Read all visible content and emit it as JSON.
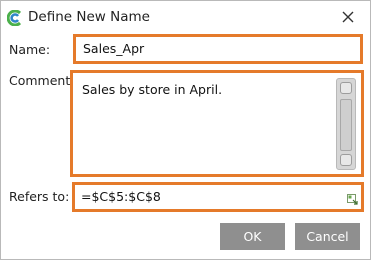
{
  "dialog": {
    "title": "Define New Name",
    "colors": {
      "highlight": "#e57a2a",
      "button_bg": "#8f8f8f",
      "logo_green": "#4bb04b",
      "logo_blue": "#2f86c9"
    }
  },
  "form": {
    "name_label": "Name:",
    "name_value": "Sales_Apr",
    "comment_label": "Comment:",
    "comment_value": "Sales by store in April.",
    "refers_label": "Refers to:",
    "refers_value": "=$C$5:$C$8"
  },
  "buttons": {
    "ok": "OK",
    "cancel": "Cancel"
  },
  "icons": {
    "app": "app-logo-icon",
    "close": "close-icon",
    "range": "range-selector-icon"
  }
}
